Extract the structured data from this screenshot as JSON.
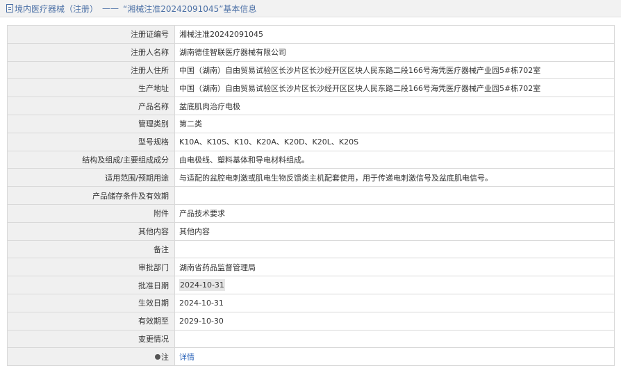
{
  "header": {
    "category": "境内医疗器械（注册）",
    "separator": "——",
    "subject": "“湘械注准20242091045”基本信息"
  },
  "rows": [
    {
      "label": "注册证编号",
      "value": "湘械注准20242091045"
    },
    {
      "label": "注册人名称",
      "value": "湖南德佳智联医疗器械有限公司"
    },
    {
      "label": "注册人住所",
      "value": "中国（湖南）自由贸易试验区长沙片区长沙经开区区块人民东路二段166号海凭医疗器械产业园5#栋702室"
    },
    {
      "label": "生产地址",
      "value": "中国（湖南）自由贸易试验区长沙片区长沙经开区区块人民东路二段166号海凭医疗器械产业园5#栋702室"
    },
    {
      "label": "产品名称",
      "value": "盆底肌肉治疗电极"
    },
    {
      "label": "管理类别",
      "value": "第二类"
    },
    {
      "label": "型号规格",
      "value": "K10A、K10S、K10、K20A、K20D、K20L、K20S"
    },
    {
      "label": "结构及组成/主要组成成分",
      "value": "由电极线、塑料基体和导电材料组成。"
    },
    {
      "label": "适用范围/预期用途",
      "value": "与适配的盆腔电刺激或肌电生物反馈类主机配套使用，用于传递电刺激信号及盆底肌电信号。"
    },
    {
      "label": "产品储存条件及有效期",
      "value": ""
    },
    {
      "label": "附件",
      "value": "产品技术要求"
    },
    {
      "label": "其他内容",
      "value": "其他内容"
    },
    {
      "label": "备注",
      "value": ""
    },
    {
      "label": "审批部门",
      "value": "湖南省药品监督管理局"
    },
    {
      "label": "批准日期",
      "value": "2024-10-31"
    },
    {
      "label": "生效日期",
      "value": "2024-10-31"
    },
    {
      "label": "有效期至",
      "value": "2029-10-30"
    },
    {
      "label": "变更情况",
      "value": ""
    }
  ],
  "note": {
    "label": "注",
    "link": "详情"
  },
  "icons": {
    "header_icon": "document-icon",
    "note_icon": "pin-icon"
  },
  "colors": {
    "link": "#2a63b8",
    "header_text": "#4a6fa5",
    "label_bg": "#f0f0f0"
  }
}
